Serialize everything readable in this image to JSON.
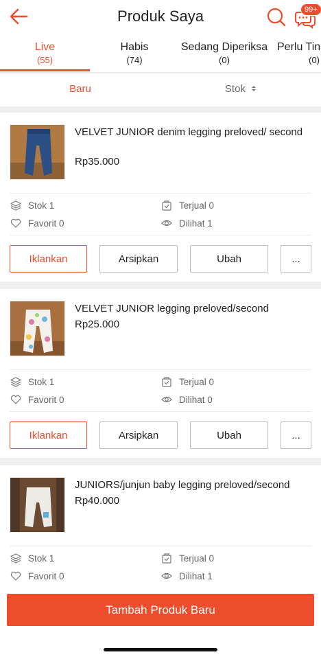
{
  "header": {
    "title": "Produk Saya",
    "chat_badge": "99+"
  },
  "colors": {
    "accent": "#ee4d2d"
  },
  "tabs": [
    {
      "label": "Live",
      "count": "(55)",
      "active": true
    },
    {
      "label": "Habis",
      "count": "(74)"
    },
    {
      "label": "Sedang Diperiksa",
      "count": "(0)"
    },
    {
      "label": "Perlu Tin",
      "count": "(0)"
    }
  ],
  "sort": {
    "baru": "Baru",
    "stok": "Stok"
  },
  "products": [
    {
      "name": "VELVET JUNIOR denim legging preloved/ second",
      "price": "Rp35.000",
      "stok": "Stok 1",
      "terjual": "Terjual 0",
      "favorit": "Favorit 0",
      "dilihat": "Dilihat 1",
      "thumb_icon": "denim-legging-photo"
    },
    {
      "name": "VELVET JUNIOR legging preloved/second",
      "price": "Rp25.000",
      "stok": "Stok 1",
      "terjual": "Terjual 0",
      "favorit": "Favorit 0",
      "dilihat": "Dilihat 0",
      "thumb_icon": "printed-legging-photo"
    },
    {
      "name": "JUNIORS/junjun baby legging preloved/second",
      "price": "Rp40.000",
      "stok": "Stok 1",
      "terjual": "Terjual 0",
      "favorit": "Favorit 0",
      "dilihat": "Dilihat 1",
      "thumb_icon": "white-legging-photo"
    }
  ],
  "actions": {
    "iklankan": "Iklankan",
    "arsipkan": "Arsipkan",
    "ubah": "Ubah",
    "more": "..."
  },
  "bottom": {
    "add_label": "Tambah Produk Baru"
  }
}
